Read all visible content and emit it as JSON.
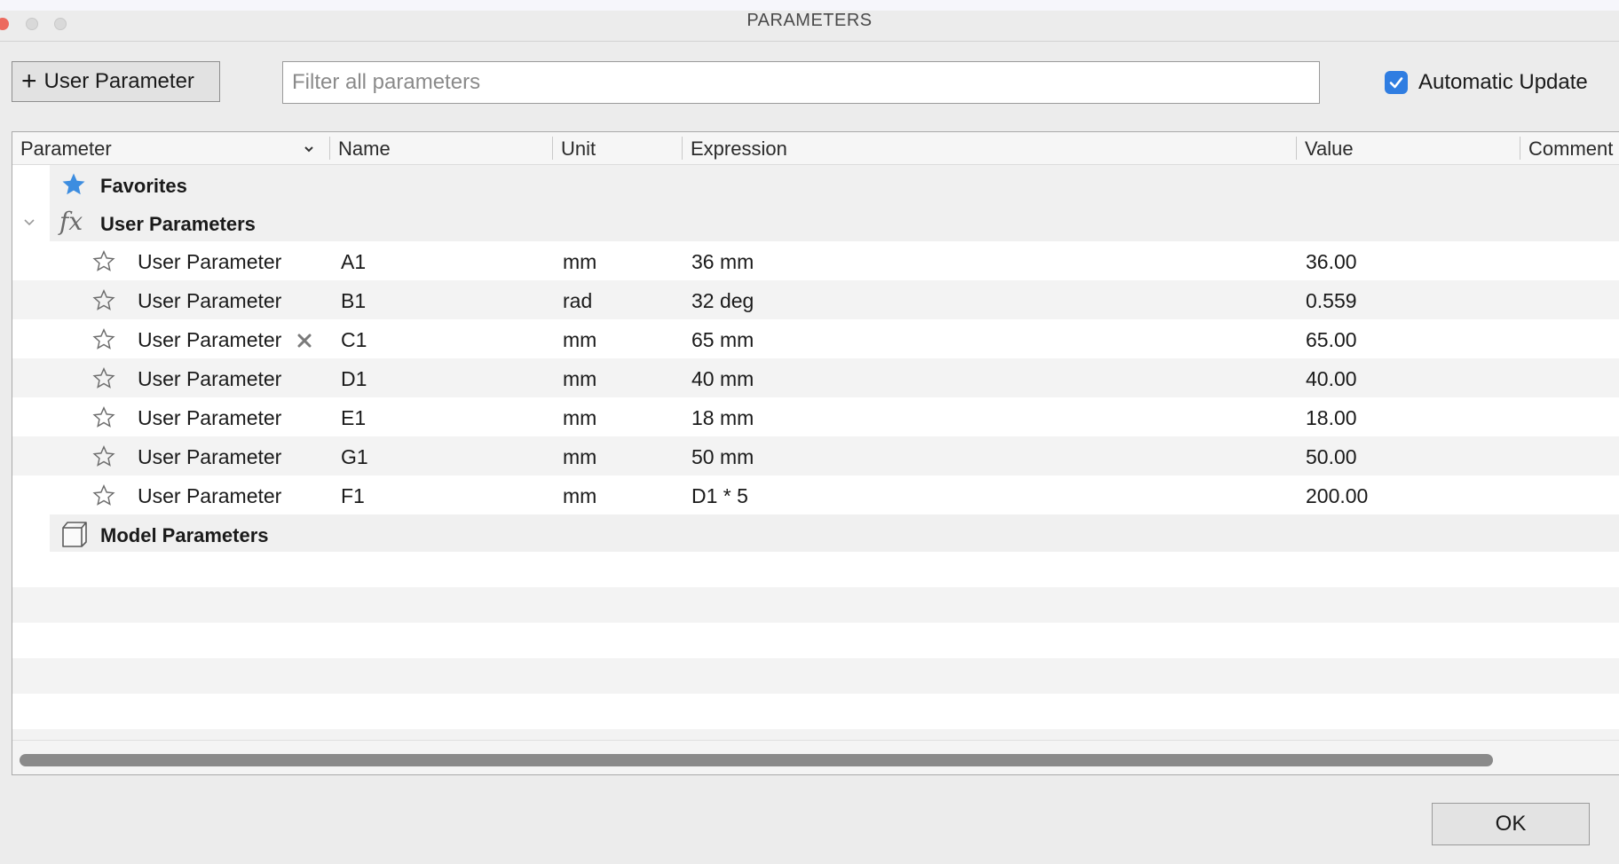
{
  "window": {
    "title": "PARAMETERS"
  },
  "toolbar": {
    "add_label": "User Parameter",
    "filter_placeholder": "Filter all parameters",
    "filter_value": "",
    "auto_update_label": "Automatic Update",
    "auto_update_checked": true
  },
  "table": {
    "columns": [
      "Parameter",
      "Name",
      "Unit",
      "Expression",
      "Value",
      "Comment"
    ],
    "groups": {
      "favorites": "Favorites",
      "user": "User Parameters",
      "model": "Model Parameters"
    },
    "rows": [
      {
        "parameter": "User Parameter",
        "name": "A1",
        "unit": "mm",
        "expression": "36 mm",
        "value": "36.00"
      },
      {
        "parameter": "User Parameter",
        "name": "B1",
        "unit": "rad",
        "expression": "32 deg",
        "value": "0.559"
      },
      {
        "parameter": "User Parameter",
        "name": "C1",
        "unit": "mm",
        "expression": "65 mm",
        "value": "65.00"
      },
      {
        "parameter": "User Parameter",
        "name": "D1",
        "unit": "mm",
        "expression": "40 mm",
        "value": "40.00"
      },
      {
        "parameter": "User Parameter",
        "name": "E1",
        "unit": "mm",
        "expression": "18 mm",
        "value": "18.00"
      },
      {
        "parameter": "User Parameter",
        "name": "G1",
        "unit": "mm",
        "expression": "50 mm",
        "value": "50.00"
      },
      {
        "parameter": "User Parameter",
        "name": "F1",
        "unit": "mm",
        "expression": "D1 * 5",
        "value": "200.00"
      }
    ]
  },
  "footer": {
    "ok_label": "OK"
  },
  "colors": {
    "accent": "#2f7de1",
    "star_fill": "#3d8de0"
  },
  "icons": [
    "plus-icon",
    "check-icon",
    "sort-chevron-icon",
    "star-filled-icon",
    "fx-icon",
    "collapse-chevron-icon",
    "star-outline-icon",
    "delete-x-icon",
    "cube-icon"
  ]
}
